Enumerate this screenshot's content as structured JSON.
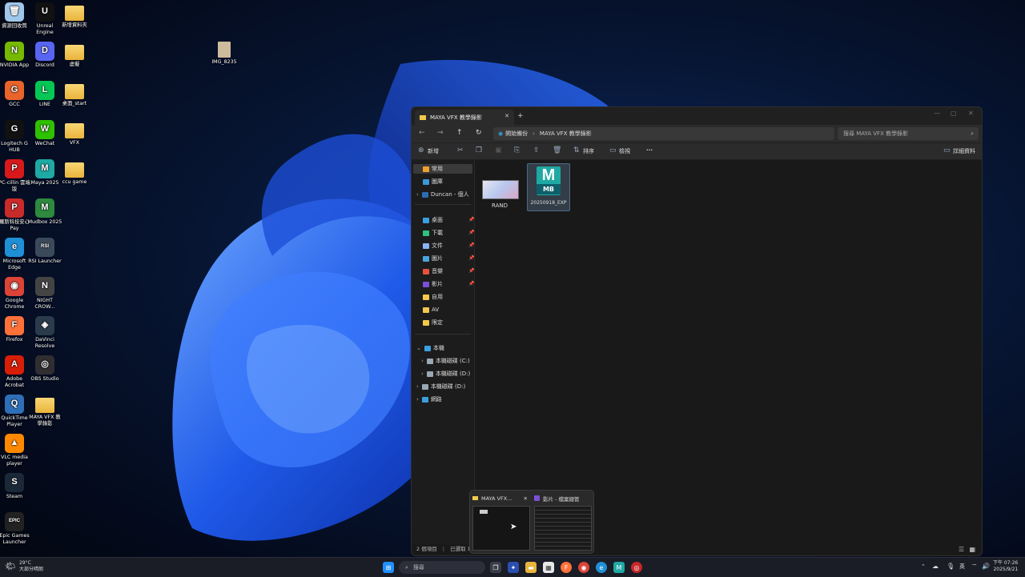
{
  "desktop": {
    "icons": [
      {
        "label": "資源回收筒",
        "icon": "recycle-bin-icon",
        "color": "#9fc7ea",
        "glyph": "🗑"
      },
      {
        "label": "Unreal Engine",
        "icon": "unreal-icon",
        "color": "#111111",
        "glyph": "U"
      },
      {
        "label": "新增資料夾",
        "icon": "folder-icon",
        "color": "#f2c94c",
        "glyph": ""
      },
      {
        "label": "NVIDIA App",
        "icon": "nvidia-icon",
        "color": "#76b900",
        "glyph": "N"
      },
      {
        "label": "Discord",
        "icon": "discord-icon",
        "color": "#5865f2",
        "glyph": "D"
      },
      {
        "label": "虛擬",
        "icon": "folder-icon",
        "color": "#f2c94c",
        "glyph": ""
      },
      {
        "label": "GCC",
        "icon": "gcc-icon",
        "color": "#e8642b",
        "glyph": "G"
      },
      {
        "label": "LINE",
        "icon": "line-icon",
        "color": "#06c755",
        "glyph": "L"
      },
      {
        "label": "桌面_start",
        "icon": "folder-icon",
        "color": "#f2c94c",
        "glyph": ""
      },
      {
        "label": "Logitech G HUB",
        "icon": "logitech-icon",
        "color": "#111111",
        "glyph": "G"
      },
      {
        "label": "WeChat",
        "icon": "wechat-icon",
        "color": "#2dc100",
        "glyph": "W"
      },
      {
        "label": "VFX",
        "icon": "folder-icon",
        "color": "#f2c94c",
        "glyph": ""
      },
      {
        "label": "PC-cillin 雲端版",
        "icon": "pccillin-icon",
        "color": "#d7191c",
        "glyph": "P"
      },
      {
        "label": "Maya 2025",
        "icon": "maya-icon",
        "color": "#1fa9a4",
        "glyph": "M"
      },
      {
        "label": "ccu game",
        "icon": "folder-icon",
        "color": "#f2c94c",
        "glyph": ""
      },
      {
        "label": "羅斯科技安心 Pay",
        "icon": "pay-icon",
        "color": "#c92a2a",
        "glyph": "P"
      },
      {
        "label": "Mudbox 2025",
        "icon": "mudbox-icon",
        "color": "#2d8a3e",
        "glyph": "M"
      },
      {
        "label": "Microsoft Edge",
        "icon": "edge-icon",
        "color": "#1f8fd6",
        "glyph": "e"
      },
      {
        "label": "RSI Launcher",
        "icon": "rsi-icon",
        "color": "#3b4a5a",
        "glyph": "RSI"
      },
      {
        "label": "Google Chrome",
        "icon": "chrome-icon",
        "color": "#db4437",
        "glyph": "◉"
      },
      {
        "label": "NIGHT CROW...",
        "icon": "nightcrow-icon",
        "color": "#444444",
        "glyph": "N"
      },
      {
        "label": "Firefox",
        "icon": "firefox-icon",
        "color": "#ff7139",
        "glyph": "F"
      },
      {
        "label": "DaVinci Resolve",
        "icon": "davinci-icon",
        "color": "#2a3b4c",
        "glyph": "◈"
      },
      {
        "label": "Adobe Acrobat",
        "icon": "acrobat-icon",
        "color": "#d81e06",
        "glyph": "A"
      },
      {
        "label": "OBS Studio",
        "icon": "obs-icon",
        "color": "#302e31",
        "glyph": "◎"
      },
      {
        "label": "QuickTime Player",
        "icon": "quicktime-icon",
        "color": "#2f6fb7",
        "glyph": "Q"
      },
      {
        "label": "MAYA VFX 教學錄影",
        "icon": "folder-icon",
        "color": "#f2c94c",
        "glyph": ""
      },
      {
        "label": "VLC media player",
        "icon": "vlc-icon",
        "color": "#ff8800",
        "glyph": "▲"
      },
      {
        "label": "Steam",
        "icon": "steam-icon",
        "color": "#1b2838",
        "glyph": "S"
      },
      {
        "label": "Epic Games Launcher",
        "icon": "epic-icon",
        "color": "#222222",
        "glyph": "EPIC"
      }
    ],
    "floating_file": {
      "label": "IMG_8235",
      "icon": "image-file-icon"
    }
  },
  "explorer": {
    "tab_title": "MAYA VFX 教學錄影",
    "tab_close": "✕",
    "new_tab": "+",
    "address": {
      "root": "開始備份",
      "sep": "›",
      "current": "MAYA VFX 教學錄影"
    },
    "search_placeholder": "搜尋 MAYA VFX 教學錄影",
    "commands": {
      "new": "新增",
      "sort": "排序",
      "view": "檢視",
      "more": "···",
      "details": "詳細資料"
    },
    "nav_items": [
      {
        "label": "常用",
        "color": "#f0a030",
        "selected": true
      },
      {
        "label": "圖庫",
        "color": "#3a9ad9"
      },
      {
        "label": "Duncan - 個人",
        "color": "#2b6cb0",
        "chevron": true
      },
      {
        "label": "桌面",
        "color": "#3aa0e0",
        "pinned": true
      },
      {
        "label": "下載",
        "color": "#2ec27e",
        "pinned": true
      },
      {
        "label": "文件",
        "color": "#8ab4f8",
        "pinned": true
      },
      {
        "label": "圖片",
        "color": "#4aa3df",
        "pinned": true
      },
      {
        "label": "音樂",
        "color": "#e5533d",
        "pinned": true
      },
      {
        "label": "影片",
        "color": "#7b4fd6",
        "pinned": true
      },
      {
        "label": "自用",
        "color": "#f2c94c"
      },
      {
        "label": "AV",
        "color": "#f2c94c"
      },
      {
        "label": "限定",
        "color": "#f2c94c"
      },
      {
        "label": "本機",
        "color": "#3aa0e0",
        "expanded": true
      },
      {
        "label": "本機磁碟 (C:)",
        "color": "#9aa7b5",
        "chevron": true
      },
      {
        "label": "本機磁碟 (D:)",
        "color": "#9aa7b5",
        "chevron": true
      },
      {
        "label": "本機磁碟 (D:)",
        "color": "#9aa7b5",
        "chevron": true
      },
      {
        "label": "網路",
        "color": "#3aa0e0",
        "chevron": true
      }
    ],
    "files": [
      {
        "name": "RAND",
        "type": "image"
      },
      {
        "name": "20250918_EXP",
        "type": "maya-binary",
        "badge": "M",
        "ext": "MB"
      }
    ],
    "status": {
      "count": "2 個項目",
      "selected": "已選取 1 個"
    }
  },
  "preview_popup": {
    "items": [
      {
        "title": "MAYA VFX...",
        "close": "✕"
      },
      {
        "title": "影片 - 檔案總管"
      }
    ]
  },
  "taskbar": {
    "weather": {
      "temp": "29°C",
      "desc": "大部分晴朗"
    },
    "search_placeholder": "搜尋",
    "lang": "英",
    "time": "下午 07:26",
    "date": "2025/9/21"
  }
}
